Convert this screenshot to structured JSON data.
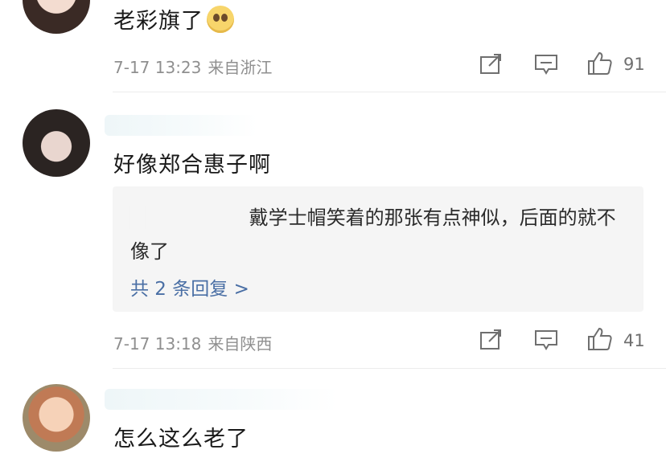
{
  "comments": [
    {
      "text": "老彩旗了",
      "emoji": "pleading-face",
      "date": "7-17 13:23",
      "location": "来自浙江",
      "likes": "91"
    },
    {
      "text": "好像郑合惠子啊",
      "date": "7-17 13:18",
      "location": "来自陕西",
      "likes": "41",
      "reply": {
        "text": "戴学士帽笑着的那张有点神似，后面的就不像了",
        "more": "共 2 条回复 >"
      }
    },
    {
      "text": "怎么这么老了"
    }
  ],
  "icons": {
    "share": "share-icon",
    "comment": "comment-icon",
    "like": "like-icon"
  },
  "colors": {
    "meta": "#8f8f8f",
    "reply_link": "#4a6fa5",
    "reply_bg": "#f5f5f5"
  }
}
